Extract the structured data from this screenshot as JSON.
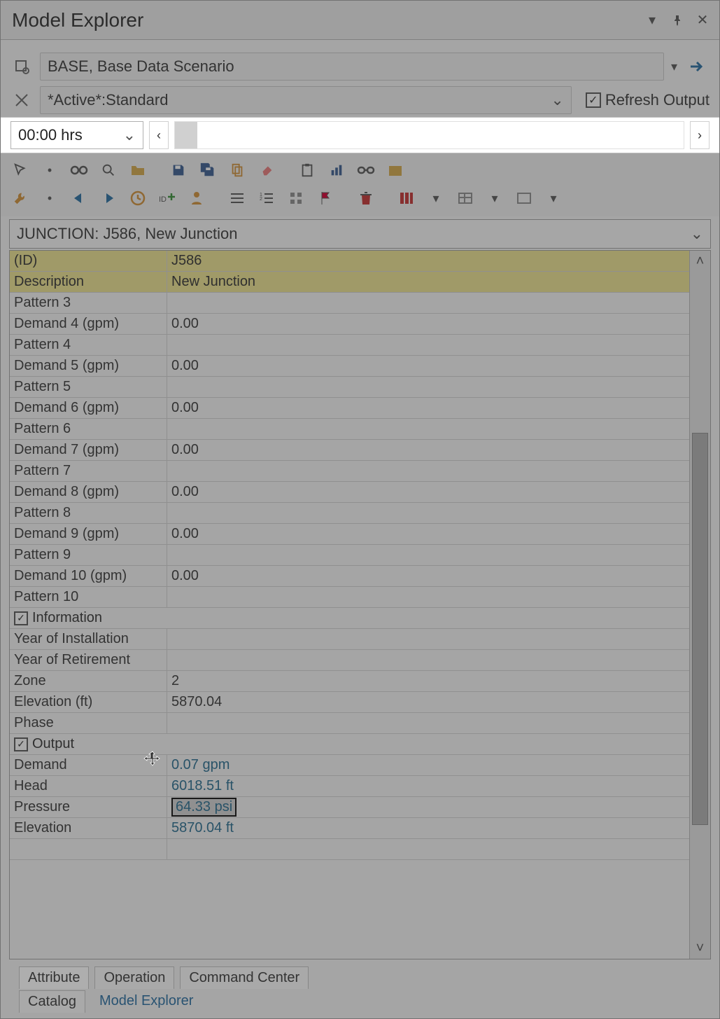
{
  "title": "Model Explorer",
  "scenario": {
    "text": "BASE, Base Data Scenario"
  },
  "dataset": {
    "text": "*Active*:Standard"
  },
  "refresh": {
    "label": "Refresh Output",
    "checked": true
  },
  "time": {
    "value": "00:00 hrs"
  },
  "element": {
    "header": "JUNCTION: J586, New Junction"
  },
  "idrow": {
    "label": "(ID)",
    "value": "J586"
  },
  "descrow": {
    "label": "Description",
    "value": "New Junction"
  },
  "rows": [
    {
      "label": "Pattern 3",
      "value": ""
    },
    {
      "label": "Demand 4 (gpm)",
      "value": "0.00"
    },
    {
      "label": "Pattern 4",
      "value": ""
    },
    {
      "label": "Demand 5 (gpm)",
      "value": "0.00"
    },
    {
      "label": "Pattern 5",
      "value": ""
    },
    {
      "label": "Demand 6 (gpm)",
      "value": "0.00"
    },
    {
      "label": "Pattern 6",
      "value": ""
    },
    {
      "label": "Demand 7 (gpm)",
      "value": "0.00"
    },
    {
      "label": "Pattern 7",
      "value": ""
    },
    {
      "label": "Demand 8 (gpm)",
      "value": "0.00"
    },
    {
      "label": "Pattern 8",
      "value": ""
    },
    {
      "label": "Demand 9 (gpm)",
      "value": "0.00"
    },
    {
      "label": "Pattern 9",
      "value": ""
    },
    {
      "label": "Demand 10 (gpm)",
      "value": "0.00"
    },
    {
      "label": "Pattern 10",
      "value": ""
    }
  ],
  "groups": {
    "info": {
      "label": "Information"
    },
    "output": {
      "label": "Output"
    }
  },
  "info_rows": [
    {
      "label": "Year of Installation",
      "value": ""
    },
    {
      "label": "Year of Retirement",
      "value": ""
    },
    {
      "label": "Zone",
      "value": "2"
    },
    {
      "label": "Elevation (ft)",
      "value": "5870.04"
    },
    {
      "label": "Phase",
      "value": ""
    }
  ],
  "output_rows": {
    "demand": {
      "label": "Demand",
      "value": "0.07 gpm"
    },
    "head": {
      "label": "Head",
      "value": "6018.51 ft"
    },
    "pressure": {
      "label": "Pressure",
      "value": "64.33 psi"
    },
    "elevation": {
      "label": "Elevation",
      "value": "5870.04 ft"
    }
  },
  "bottom_tabs": {
    "row1": [
      "Attribute",
      "Operation",
      "Command Center"
    ],
    "row2": [
      "Catalog",
      "Model Explorer"
    ]
  }
}
